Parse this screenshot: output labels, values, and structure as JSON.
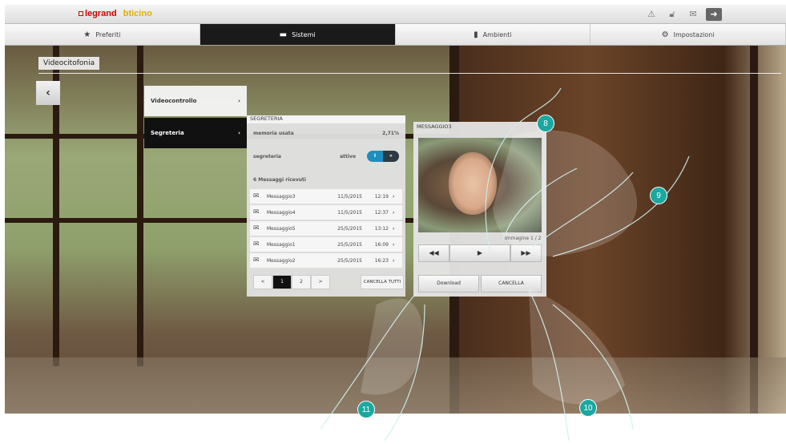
{
  "topbar": {
    "brand_legrand": "legrand",
    "brand_bticino": "bticino",
    "icons": [
      "warning-icon",
      "lock-icon",
      "mail-icon",
      "exit-icon"
    ]
  },
  "menu": {
    "items": [
      {
        "label": "Preferiti",
        "icon": "star-icon"
      },
      {
        "label": "Sistemi",
        "icon": "system-icon"
      },
      {
        "label": "Ambienti",
        "icon": "room-icon"
      },
      {
        "label": "Impostazioni",
        "icon": "settings-icon"
      }
    ],
    "active_index": 1
  },
  "section": {
    "title": "Videocitofonia",
    "back": "‹"
  },
  "submenu": {
    "items": [
      {
        "label": "Videocontrollo",
        "arrow": "›"
      },
      {
        "label": "Segreteria",
        "arrow": "›"
      }
    ]
  },
  "segreteria": {
    "title": "SEGRETERIA",
    "memoria_label": "memoria usata",
    "memoria_value": "2,71%",
    "status_label": "segreteria",
    "status_value": "attivo",
    "toggle_on": "I",
    "toggle_off": "»",
    "messages_count_label": "6 Messaggi ricevuti",
    "messages": [
      {
        "name": "Messaggio3",
        "date": "11/5/2015",
        "time": "12:19"
      },
      {
        "name": "Messaggio4",
        "date": "11/5/2015",
        "time": "12:37"
      },
      {
        "name": "Messaggio5",
        "date": "25/5/2015",
        "time": "13:12"
      },
      {
        "name": "Messaggio1",
        "date": "25/5/2015",
        "time": "16:09"
      },
      {
        "name": "Messaggio2",
        "date": "25/5/2015",
        "time": "16:23"
      }
    ],
    "pager": [
      "<",
      "1",
      "2",
      ">"
    ],
    "pager_current": "1",
    "cancel_all": "CANCELLA TUTTI"
  },
  "message": {
    "title": "MESSAGGIO3",
    "image_counter": "Immagine 1 / 2",
    "prev": "◀◀",
    "play": "▶",
    "next": "▶▶",
    "download": "Download",
    "delete": "CANCELLA"
  },
  "callouts": [
    "8",
    "9",
    "10",
    "11"
  ],
  "colors": {
    "accent": "#1aa8a0",
    "toggle_on": "#1b8fbf",
    "active_menu": "#1a1a1a"
  }
}
